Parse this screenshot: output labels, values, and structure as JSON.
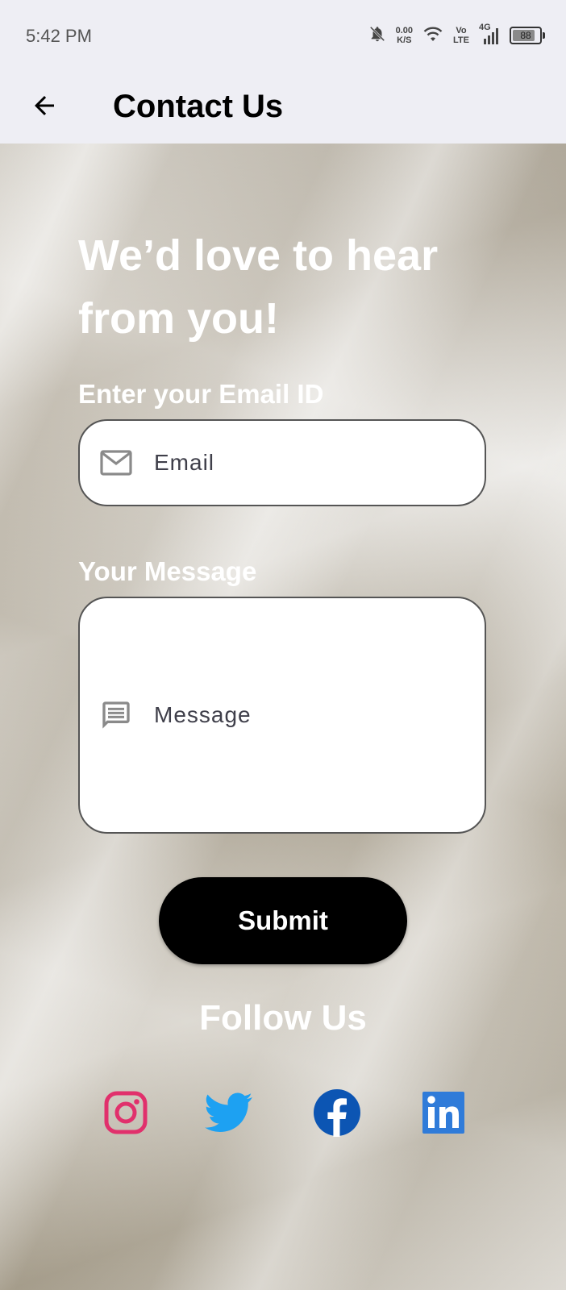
{
  "status_bar": {
    "time": "5:42 PM",
    "net_speed_value": "0.00",
    "net_speed_unit": "K/S",
    "volte_top": "Vo",
    "volte_bottom": "LTE",
    "network": "4G",
    "battery": "88"
  },
  "app_bar": {
    "title": "Contact Us",
    "back_icon": "arrow-back-icon"
  },
  "form": {
    "headline": "We’d love to hear from you!",
    "email_label": "Enter your Email ID",
    "email_placeholder": "Email",
    "email_value": "",
    "email_icon": "mail-icon",
    "message_label": "Your Message",
    "message_placeholder": "Message",
    "message_value": "",
    "message_icon": "message-icon",
    "submit_label": "Submit"
  },
  "social": {
    "title": "Follow Us",
    "items": [
      {
        "name": "instagram",
        "icon": "instagram-icon",
        "color": "#E1306C"
      },
      {
        "name": "twitter",
        "icon": "twitter-icon",
        "color": "#1DA1F2"
      },
      {
        "name": "facebook",
        "icon": "facebook-icon",
        "color": "#0C55B3"
      },
      {
        "name": "linkedin",
        "icon": "linkedin-icon",
        "color": "#2F7BD9"
      }
    ]
  },
  "colors": {
    "app_bar_bg": "#eeeef4",
    "submit_bg": "#000000",
    "headline_text": "#ffffff"
  }
}
